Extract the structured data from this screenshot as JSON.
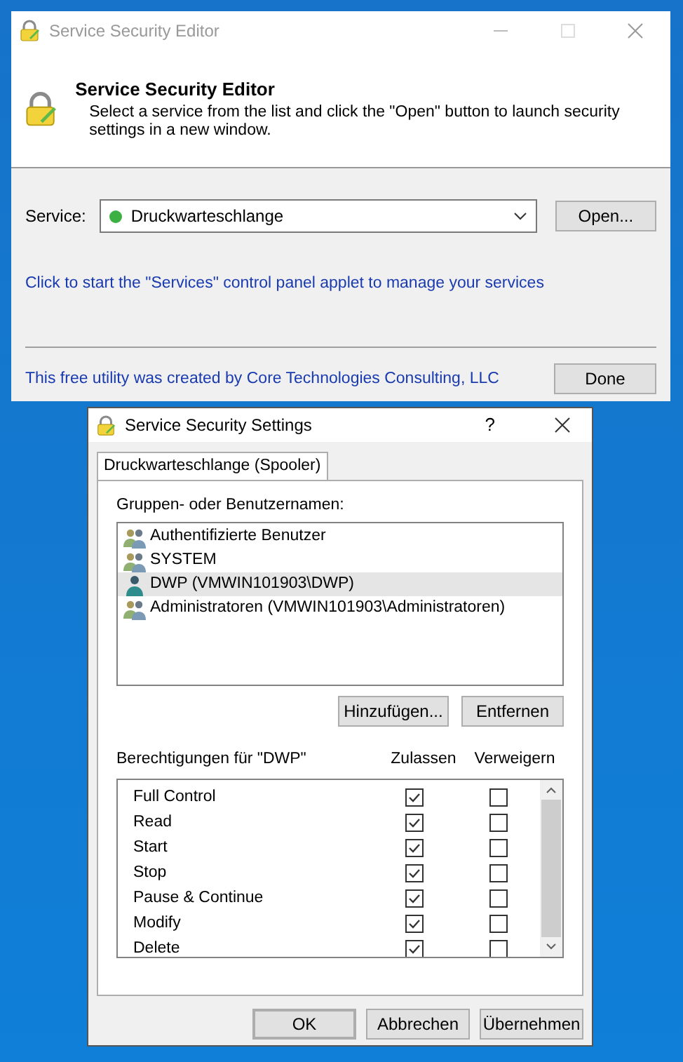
{
  "main_window": {
    "title": "Service Security Editor",
    "header_title": "Service Security Editor",
    "header_text": "Select a service from the list and click the \"Open\" button to launch security settings in a new window.",
    "service_label": "Service:",
    "service_value": "Druckwarteschlange",
    "open_button": "Open...",
    "services_link": "Click to start the \"Services\" control panel applet to manage your services",
    "credit": "This free utility was created by Core Technologies Consulting, LLC",
    "done_button": "Done"
  },
  "settings_window": {
    "title": "Service Security Settings",
    "help": "?",
    "tab": "Druckwarteschlange (Spooler)",
    "users_label": "Gruppen- oder Benutzernamen:",
    "users": [
      {
        "name": "Authentifizierte Benutzer",
        "kind": "group",
        "selected": false
      },
      {
        "name": "SYSTEM",
        "kind": "group",
        "selected": false
      },
      {
        "name": "DWP (VMWIN101903\\DWP)",
        "kind": "user",
        "selected": true
      },
      {
        "name": "Administratoren (VMWIN101903\\Administratoren)",
        "kind": "group",
        "selected": false
      }
    ],
    "add_button": "Hinzufügen...",
    "remove_button": "Entfernen",
    "permissions_label": "Berechtigungen für \"DWP\"",
    "allow_header": "Zulassen",
    "deny_header": "Verweigern",
    "permissions": [
      {
        "name": "Full Control",
        "allow": true,
        "deny": false
      },
      {
        "name": "Read",
        "allow": true,
        "deny": false
      },
      {
        "name": "Start",
        "allow": true,
        "deny": false
      },
      {
        "name": "Stop",
        "allow": true,
        "deny": false
      },
      {
        "name": "Pause & Continue",
        "allow": true,
        "deny": false
      },
      {
        "name": "Modify",
        "allow": true,
        "deny": false
      },
      {
        "name": "Delete",
        "allow": true,
        "deny": false
      }
    ],
    "buttons": [
      "OK",
      "Abbrechen",
      "Übernehmen"
    ]
  }
}
